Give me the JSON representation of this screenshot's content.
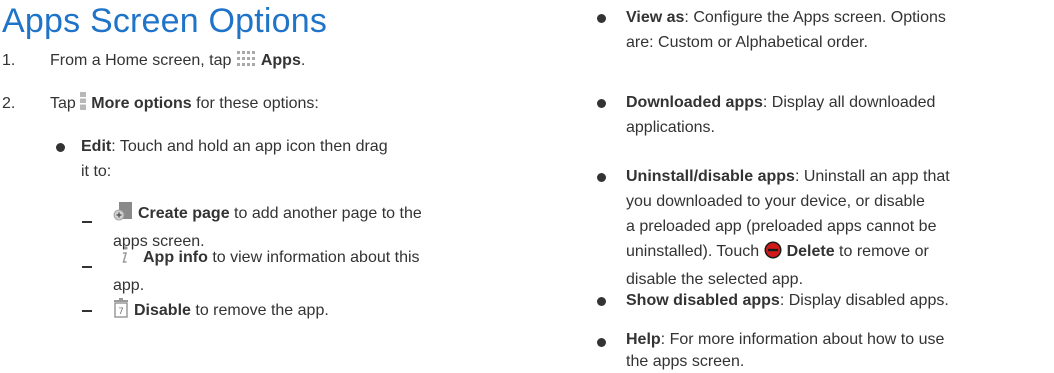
{
  "title": "Apps Screen Options",
  "left": {
    "step1": {
      "num": "1.",
      "pre": "From a Home screen, tap ",
      "bold": "Apps",
      "post": "."
    },
    "step2": {
      "num": "2.",
      "pre": "Tap ",
      "bold": "More options",
      "post": " for these options:"
    },
    "edit": {
      "bold": "Edit",
      "text_line1": ": Touch and hold an app icon then drag",
      "text_line2": "it to:"
    },
    "sub1": {
      "bold": "Create page",
      "text_line1": " to add another page to the",
      "text_line2": "apps screen."
    },
    "sub2": {
      "bold": "App info",
      "text_line1": " to view information about this",
      "text_line2": "app."
    },
    "sub3": {
      "bold": "Disable",
      "text": " to remove the app."
    }
  },
  "right": {
    "view_as": {
      "bold": "View as",
      "line1": ": Configure the Apps screen. Options",
      "line2": "are: Custom or Alphabetical order."
    },
    "downloaded": {
      "bold": "Downloaded apps",
      "line1": ": Display all downloaded",
      "line2": "applications."
    },
    "uninstall": {
      "bold": "Uninstall/disable apps",
      "line1": ": Uninstall an app that",
      "line2": "you downloaded to your device, or disable",
      "line3": "a preloaded app (preloaded apps cannot be",
      "line4_pre": "uninstalled). Touch ",
      "line4_bold": "Delete",
      "line4_post": " to remove or",
      "line5": "disable the selected app."
    },
    "show_disabled": {
      "bold": "Show disabled apps",
      "text": ": Display disabled apps."
    },
    "help": {
      "bold": "Help",
      "line1": ": For more information about how to use",
      "line2": "the apps screen."
    }
  },
  "icons": {
    "apps": "apps-grid-icon",
    "more": "more-options-icon",
    "create_page": "create-page-icon",
    "app_info": "info-icon",
    "disable": "disable-icon",
    "delete": "delete-icon"
  },
  "colors": {
    "title": "#1f74c9",
    "text": "#333333",
    "delete": "#d11919"
  }
}
